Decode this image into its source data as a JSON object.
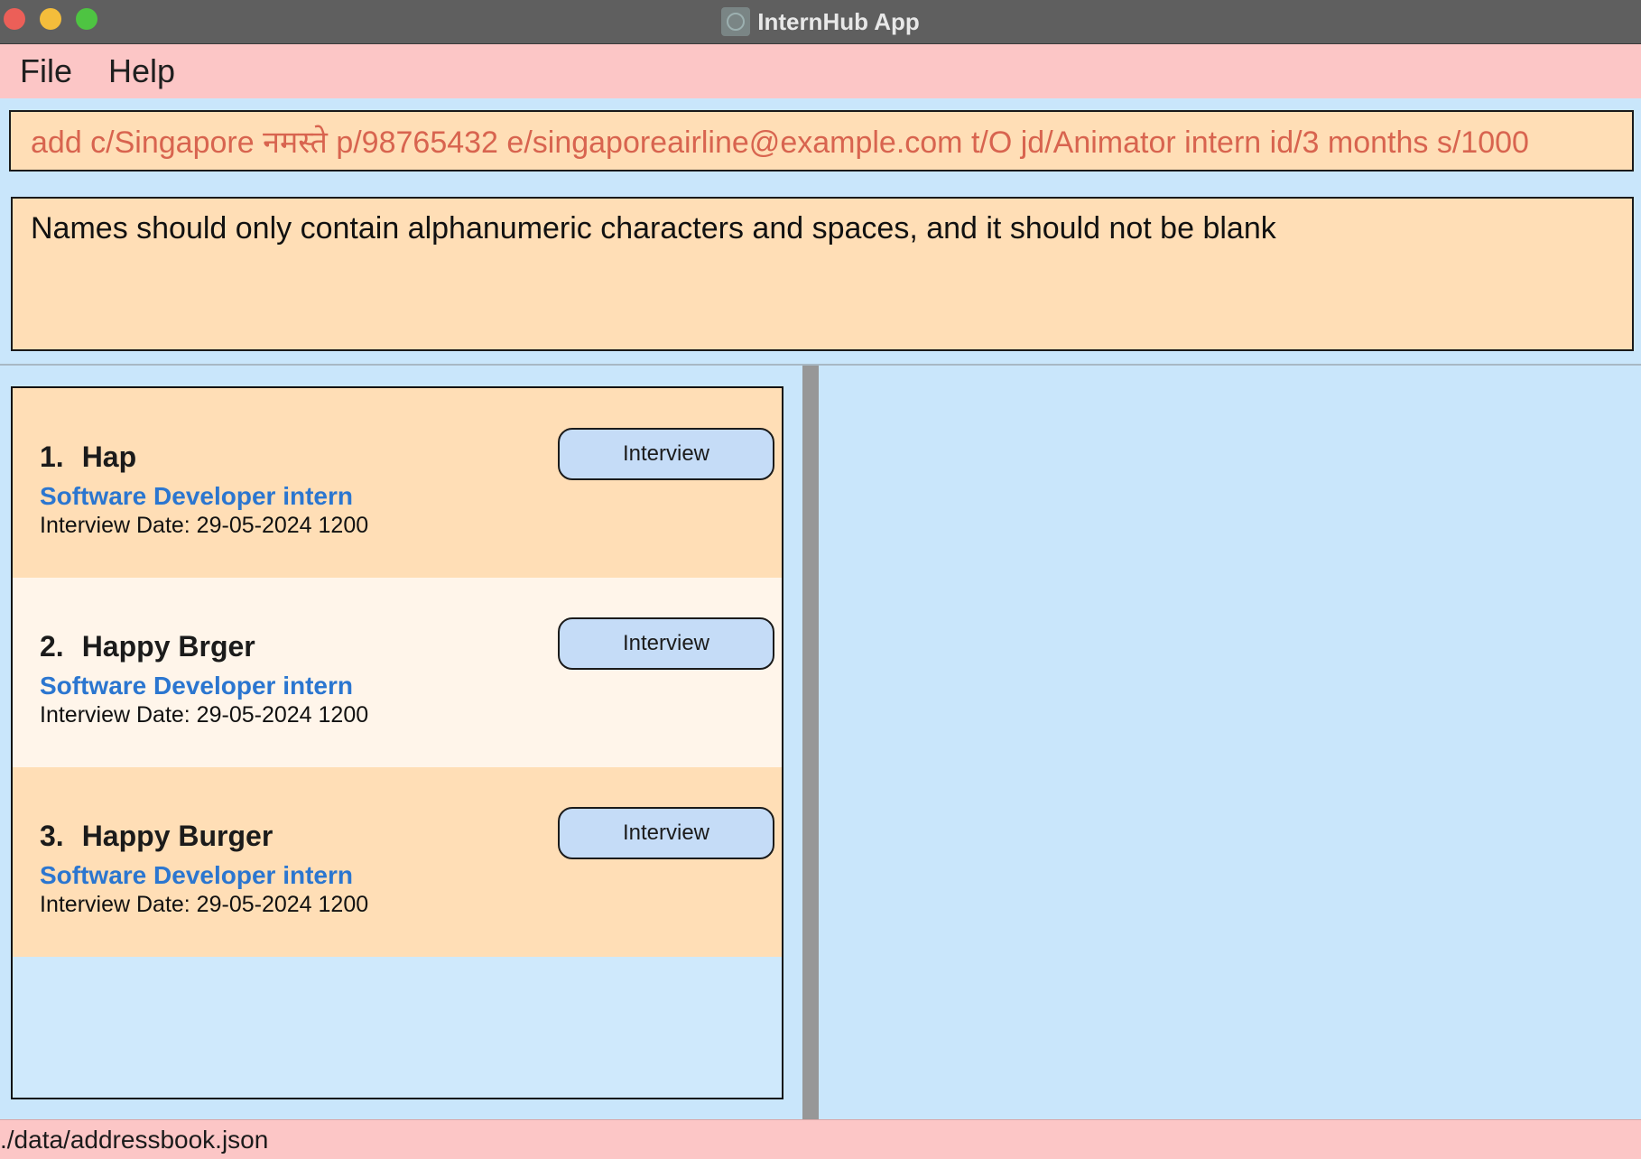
{
  "window": {
    "title": "InternHub App"
  },
  "menu": {
    "items": [
      "File",
      "Help"
    ]
  },
  "command": {
    "value": "add c/Singapore नमस्ते p/98765432 e/singaporeairline@example.com t/O jd/Animator intern id/3 months s/1000"
  },
  "result": {
    "message": "Names should only contain alphanumeric characters and spaces, and it should not be blank"
  },
  "list": {
    "cards": [
      {
        "index": "1.",
        "name": "Hap",
        "role": "Software Developer intern",
        "date": "Interview Date: 29-05-2024 1200",
        "status": "Interview"
      },
      {
        "index": "2.",
        "name": "Happy Brger",
        "role": "Software Developer intern",
        "date": "Interview Date: 29-05-2024 1200",
        "status": "Interview"
      },
      {
        "index": "3.",
        "name": "Happy Burger",
        "role": "Software Developer intern",
        "date": "Interview Date: 29-05-2024 1200",
        "status": "Interview"
      }
    ]
  },
  "statusbar": {
    "path": "./data/addressbook.json"
  },
  "colors": {
    "title_bar": "#5f5f5f",
    "menu_bar": "#fcc6c6",
    "panel_bg": "#c9e6fb",
    "card_odd": "#ffdeb6",
    "card_even": "#fff5ea",
    "command_text": "#d8644f",
    "role_text": "#2b76d0"
  }
}
